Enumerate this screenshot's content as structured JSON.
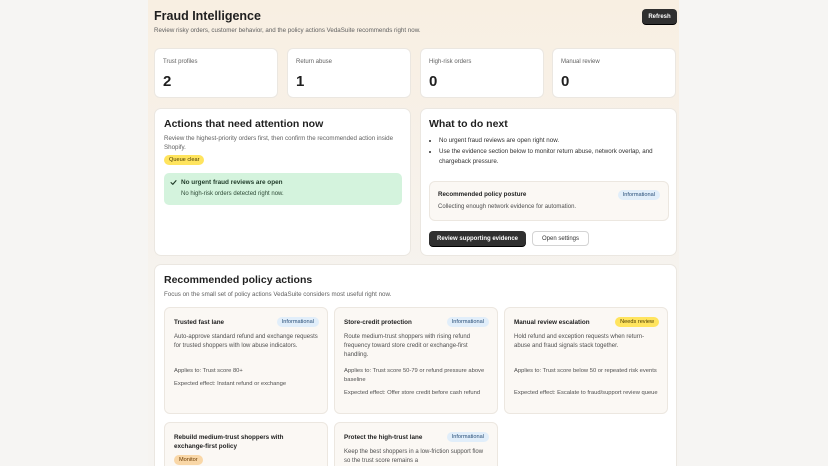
{
  "header": {
    "title": "Fraud Intelligence",
    "subtitle": "Review risky orders, customer behavior, and the policy actions VedaSuite recommends right now.",
    "refresh_label": "Refresh"
  },
  "stats": [
    {
      "label": "Trust profiles",
      "value": "2"
    },
    {
      "label": "Return abuse",
      "value": "1"
    },
    {
      "label": "High-risk orders",
      "value": "0"
    },
    {
      "label": "Manual review",
      "value": "0"
    }
  ],
  "attention": {
    "title": "Actions that need attention now",
    "description": "Review the highest-priority orders first, then confirm the recommended action inside Shopify.",
    "badge": "Queue clear",
    "alert_title": "No urgent fraud reviews are open",
    "alert_text": "No high-risk orders detected right now."
  },
  "next": {
    "title": "What to do next",
    "bullets": [
      "No urgent fraud reviews are open right now.",
      "Use the evidence section below to monitor return abuse, network overlap, and chargeback pressure."
    ],
    "posture_title": "Recommended policy posture",
    "posture_badge": "Informational",
    "posture_text": "Collecting enough network evidence for automation.",
    "primary_button": "Review supporting evidence",
    "secondary_button": "Open settings"
  },
  "policy": {
    "title": "Recommended policy actions",
    "description": "Focus on the small set of policy actions VedaSuite considers most useful right now.",
    "cards": [
      {
        "title": "Trusted fast lane",
        "badge": "Informational",
        "description": "Auto-approve standard refund and exchange requests for trusted shoppers with low abuse indicators.",
        "applies": "Applies to: Trust score 80+",
        "effect": "Expected effect: Instant refund or exchange"
      },
      {
        "title": "Store-credit protection",
        "badge": "Informational",
        "description": "Route medium-trust shoppers with rising refund frequency toward store credit or exchange-first handling.",
        "applies": "Applies to: Trust score 50-79 or refund pressure above baseline",
        "effect": "Expected effect: Offer store credit before cash refund"
      },
      {
        "title": "Manual review escalation",
        "badge": "Needs review",
        "description": "Hold refund and exception requests when return-abuse and fraud signals stack together.",
        "applies": "Applies to: Trust score below 50 or repeated risk events",
        "effect": "Expected effect: Escalate to fraud/support review queue"
      },
      {
        "title": "Rebuild medium-trust shoppers with exchange-first policy",
        "badge": "Monitor"
      },
      {
        "title": "Protect the high-trust lane",
        "badge": "Informational",
        "description": "Keep the best shoppers in a low-friction support flow so the trust score remains a"
      }
    ]
  },
  "colors": {
    "accent_dark": "#303030",
    "success_bg": "#d4f3dd",
    "warning_badge": "#ffe45e",
    "info_badge": "#e1eefa",
    "monitor_badge": "#f9d7a7"
  },
  "icons": {
    "alert": "checkmark-icon"
  }
}
